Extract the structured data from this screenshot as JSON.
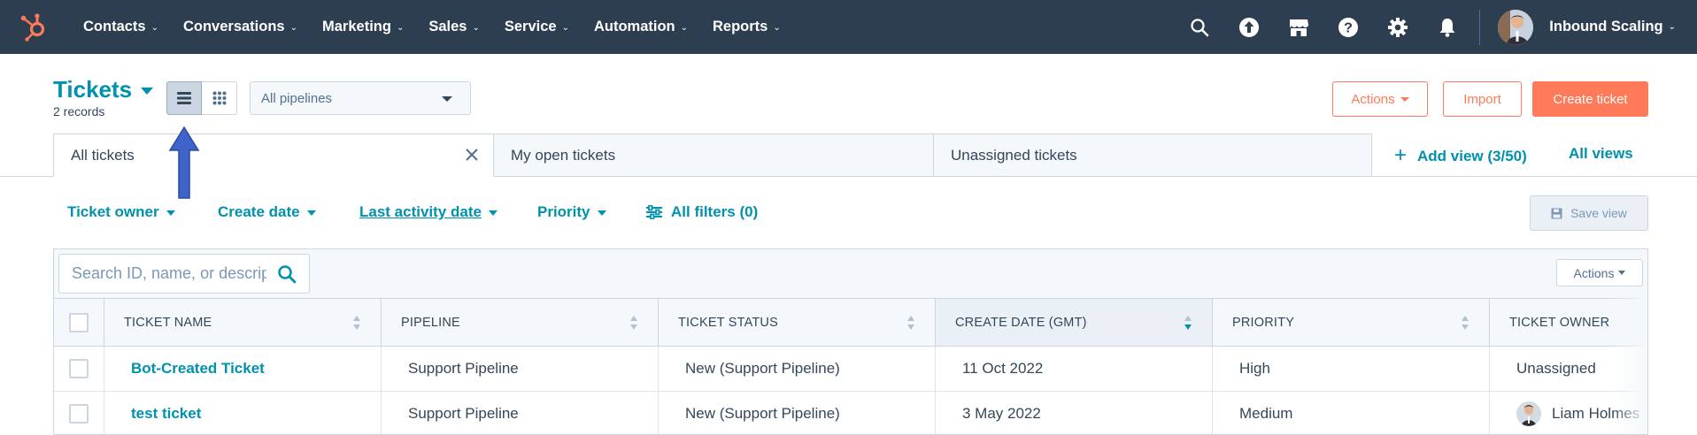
{
  "nav": {
    "items": [
      {
        "label": "Contacts"
      },
      {
        "label": "Conversations"
      },
      {
        "label": "Marketing"
      },
      {
        "label": "Sales"
      },
      {
        "label": "Service"
      },
      {
        "label": "Automation"
      },
      {
        "label": "Reports"
      }
    ],
    "icons": [
      "search-icon",
      "upgrade-icon",
      "marketplace-icon",
      "help-icon",
      "settings-icon",
      "notifications-icon"
    ],
    "account_name": "Inbound Scaling"
  },
  "header": {
    "title": "Tickets",
    "records": "2 records",
    "pipeline_select": "All pipelines",
    "actions_label": "Actions",
    "import_label": "Import",
    "create_label": "Create ticket"
  },
  "tabs": [
    {
      "label": "All tickets",
      "active": true
    },
    {
      "label": "My open tickets",
      "active": false
    },
    {
      "label": "Unassigned tickets",
      "active": false
    }
  ],
  "add_view_label": "Add view (3/50)",
  "all_views_label": "All views",
  "filters": [
    {
      "label": "Ticket owner"
    },
    {
      "label": "Create date"
    },
    {
      "label": "Last activity date"
    },
    {
      "label": "Priority"
    }
  ],
  "all_filters_label": "All filters (0)",
  "save_view_label": "Save view",
  "table": {
    "search_placeholder": "Search ID, name, or description",
    "actions_label": "Actions",
    "columns": [
      "Ticket name",
      "Pipeline",
      "Ticket status",
      "Create date (GMT)",
      "Priority",
      "Ticket owner"
    ],
    "rows": [
      {
        "name": "Bot-Created Ticket",
        "pipeline": "Support Pipeline",
        "status": "New (Support Pipeline)",
        "created": "11 Oct 2022",
        "priority": "High",
        "owner": "Unassigned"
      },
      {
        "name": "test ticket",
        "pipeline": "Support Pipeline",
        "status": "New (Support Pipeline)",
        "created": "3 May 2022",
        "priority": "Medium",
        "owner": "Liam Holmes"
      }
    ]
  },
  "colors": {
    "nav_bg": "#2d3e50",
    "accent": "#0091ae",
    "orange": "#ff7a59",
    "annotation_arrow": "#3f63c9"
  }
}
